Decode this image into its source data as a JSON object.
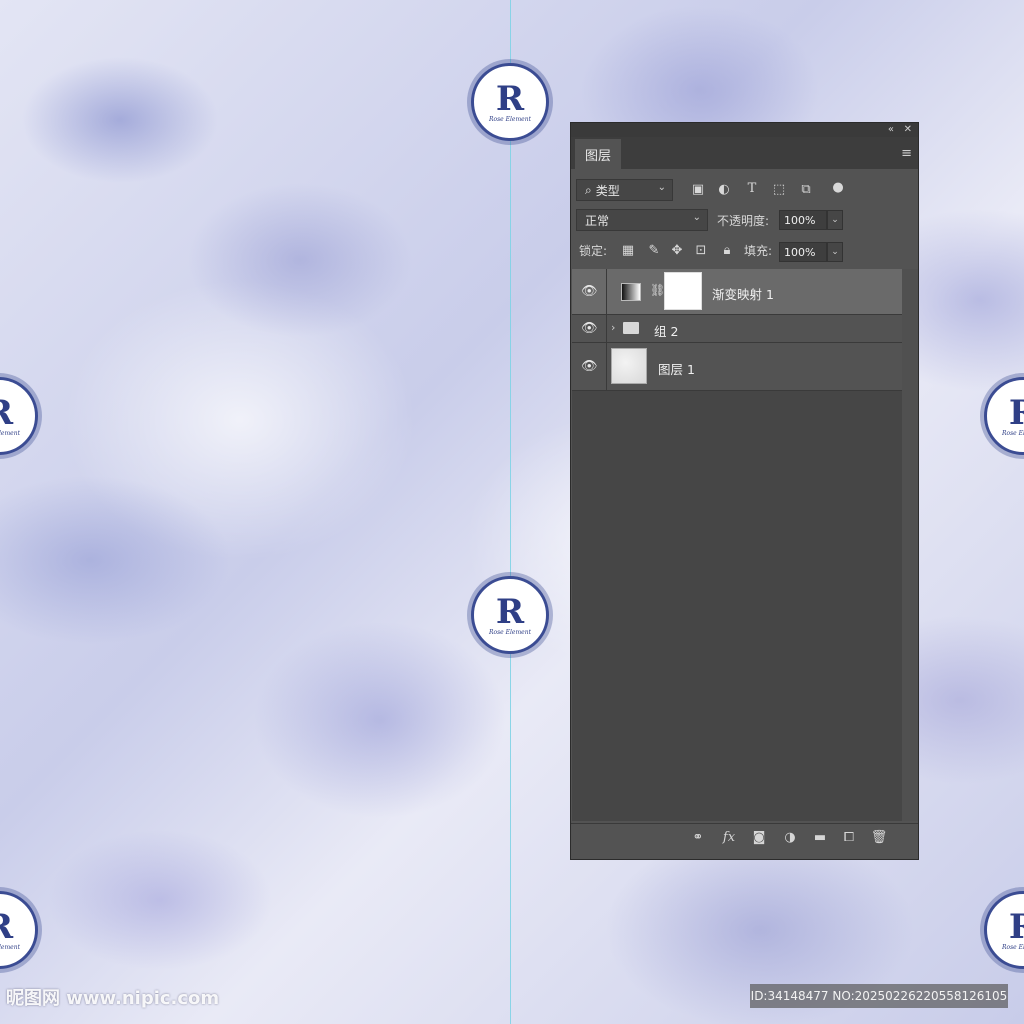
{
  "panel": {
    "tab_label": "图层",
    "filter": {
      "label": "类型"
    },
    "blend_mode": "正常",
    "opacity_label": "不透明度:",
    "opacity_value": "100%",
    "lock_label": "锁定:",
    "fill_label": "填充:",
    "fill_value": "100%",
    "layers": [
      {
        "name": "渐变映射 1",
        "kind": "adjustment",
        "selected": true
      },
      {
        "name": "组 2",
        "kind": "group",
        "selected": false
      },
      {
        "name": "图层 1",
        "kind": "pixel",
        "selected": false
      }
    ]
  },
  "watermark": {
    "left": "昵图网 www.nipic.com",
    "right": "ID:34148477 NO:20250226220558126105"
  },
  "emblem": {
    "letter": "R",
    "caption": "Rose Element"
  },
  "colors": {
    "panel_bg": "#535353",
    "selected_layer": "#6a6a6a",
    "emblem_blue": "#2f3f86",
    "guide": "#7fd3e6"
  },
  "icons": {
    "filter_icons": [
      "image-filter-icon",
      "adjustment-filter-icon",
      "text-filter-icon",
      "shape-filter-icon",
      "smart-object-filter-icon",
      "filter-toggle-icon"
    ],
    "lock_icons": [
      "lock-transparent-icon",
      "lock-paint-icon",
      "lock-move-icon",
      "lock-artboard-icon",
      "lock-all-icon"
    ],
    "bottom_icons": [
      "link-layers-icon",
      "fx-icon",
      "mask-icon",
      "new-adjustment-icon",
      "new-group-icon",
      "new-layer-icon",
      "delete-icon"
    ]
  }
}
